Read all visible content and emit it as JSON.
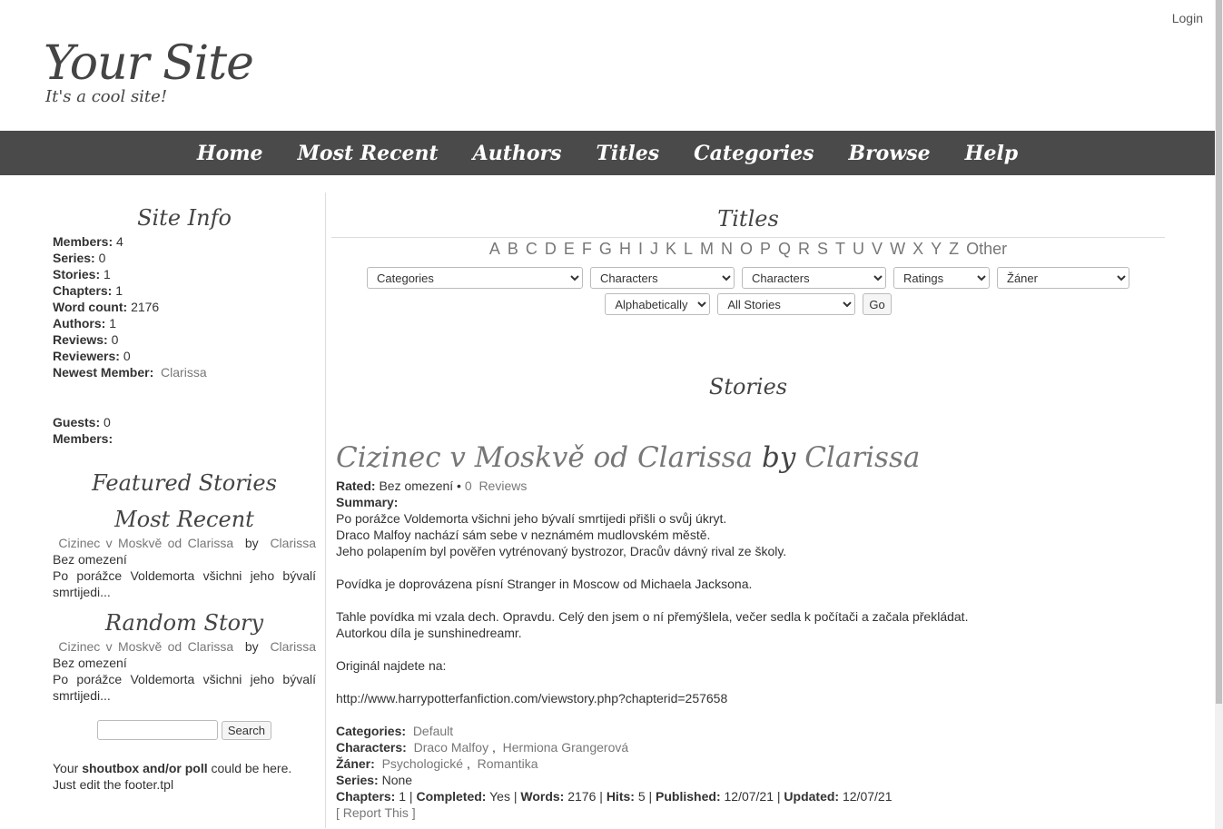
{
  "header": {
    "login": "Login",
    "site_title": "Your Site",
    "slogan": "It's a cool site!"
  },
  "nav": [
    "Home",
    "Most Recent",
    "Authors",
    "Titles",
    "Categories",
    "Browse",
    "Help"
  ],
  "sidebar": {
    "site_info_heading": "Site Info",
    "stats": [
      {
        "label": "Members:",
        "value": "4"
      },
      {
        "label": "Series:",
        "value": "0"
      },
      {
        "label": "Stories:",
        "value": "1"
      },
      {
        "label": "Chapters:",
        "value": "1"
      },
      {
        "label": "Word count:",
        "value": "2176"
      },
      {
        "label": "Authors:",
        "value": "1"
      },
      {
        "label": "Reviews:",
        "value": "0"
      },
      {
        "label": "Reviewers:",
        "value": "0"
      }
    ],
    "newest_member_label": "Newest Member:",
    "newest_member": "Clarissa",
    "guests_label": "Guests:",
    "guests_value": "0",
    "online_members_label": "Members:",
    "featured_heading": "Featured Stories",
    "most_recent_heading": "Most Recent",
    "most_recent": {
      "title": "Cizinec v Moskvě od Clarissa",
      "by": "by",
      "author": "Clarissa",
      "rating": "Bez omezení",
      "summary": "Po porážce Voldemorta všichni jeho bývalí smrtijedi..."
    },
    "random_heading": "Random Story",
    "random": {
      "title": "Cizinec v Moskvě od Clarissa",
      "by": "by",
      "author": "Clarissa",
      "rating": "Bez omezení",
      "summary": "Po porážce Voldemorta všichni jeho bývalí smrtijedi..."
    },
    "search_button": "Search",
    "footer_note_pre": "Your ",
    "footer_note_bold": "shoutbox and/or poll",
    "footer_note_post": " could be here. Just edit the footer.tpl"
  },
  "main": {
    "titles_heading": "Titles",
    "letters": [
      "A",
      "B",
      "C",
      "D",
      "E",
      "F",
      "G",
      "H",
      "I",
      "J",
      "K",
      "L",
      "M",
      "N",
      "O",
      "P",
      "Q",
      "R",
      "S",
      "T",
      "U",
      "V",
      "W",
      "X",
      "Y",
      "Z",
      "Other"
    ],
    "filters": {
      "categories": "Categories",
      "characters_1": "Characters",
      "characters_2": "Characters",
      "ratings": "Ratings",
      "genre": "Žáner",
      "sort": "Alphabetically",
      "status": "All Stories",
      "go": "Go"
    },
    "stories_heading": "Stories"
  },
  "story": {
    "title": "Cizinec v Moskvě od Clarissa",
    "by": "by",
    "author": "Clarissa",
    "rated_label": "Rated:",
    "rated_value": "Bez omezení",
    "reviews_count": "0",
    "reviews_label": "Reviews",
    "summary_label": "Summary:",
    "summary_lines": [
      "Po porážce Voldemorta všichni jeho bývalí smrtijedi přišli o svůj úkryt.",
      "Draco Malfoy nachází sám sebe v neznámém mudlovském městě.",
      "Jeho polapením byl pověřen vytrénovaný bystrozor, Dracův dávný rival ze školy.",
      "",
      "Povídka je doprovázena písní Stranger in Moscow od Michaela Jacksona.",
      "",
      "Tahle povídka mi vzala dech. Opravdu. Celý den jsem o ní přemýšlela, večer sedla k počítači a začala překládat.",
      "Autorkou díla je sunshinedreamr.",
      "",
      "Originál najdete na:",
      "",
      "http://www.harrypotterfanfiction.com/viewstory.php?chapterid=257658",
      ""
    ],
    "categories_label": "Categories:",
    "categories": "Default",
    "characters_label": "Characters:",
    "character_1": "Draco Malfoy",
    "character_2": "Hermiona Grangerová",
    "genre_label": "Žáner:",
    "genre_1": "Psychologické",
    "genre_2": "Romantika",
    "series_label": "Series:",
    "series_value": "None",
    "chapters_label": "Chapters:",
    "chapters_value": "1",
    "completed_label": "Completed:",
    "completed_value": "Yes",
    "words_label": "Words:",
    "words_value": "2176",
    "hits_label": "Hits:",
    "hits_value": "5",
    "published_label": "Published:",
    "published_value": "12/07/21",
    "updated_label": "Updated:",
    "updated_value": "12/07/21",
    "report": "Report This"
  }
}
